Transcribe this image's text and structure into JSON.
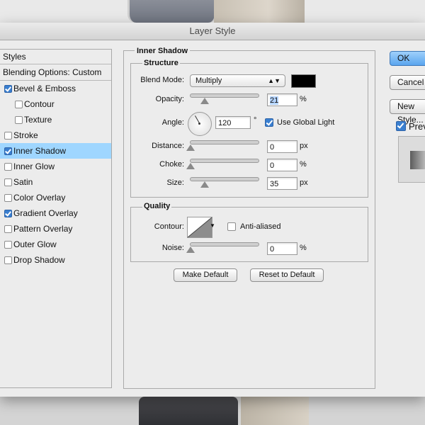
{
  "window": {
    "title": "Layer Style"
  },
  "styles_list": {
    "header": "Styles",
    "blending_options": "Blending Options: Custom",
    "items": [
      {
        "label": "Bevel & Emboss",
        "checked": true,
        "sub": false
      },
      {
        "label": "Contour",
        "checked": false,
        "sub": true
      },
      {
        "label": "Texture",
        "checked": false,
        "sub": true
      },
      {
        "label": "Stroke",
        "checked": false,
        "sub": false
      },
      {
        "label": "Inner Shadow",
        "checked": true,
        "sub": false,
        "selected": true
      },
      {
        "label": "Inner Glow",
        "checked": false,
        "sub": false
      },
      {
        "label": "Satin",
        "checked": false,
        "sub": false
      },
      {
        "label": "Color Overlay",
        "checked": false,
        "sub": false
      },
      {
        "label": "Gradient Overlay",
        "checked": true,
        "sub": false
      },
      {
        "label": "Pattern Overlay",
        "checked": false,
        "sub": false
      },
      {
        "label": "Outer Glow",
        "checked": false,
        "sub": false
      },
      {
        "label": "Drop Shadow",
        "checked": false,
        "sub": false
      }
    ]
  },
  "panel": {
    "title": "Inner Shadow",
    "structure": {
      "title": "Structure",
      "blend_mode_label": "Blend Mode:",
      "blend_mode_value": "Multiply",
      "blend_color": "#000000",
      "opacity_label": "Opacity:",
      "opacity_value": "21",
      "opacity_unit": "%",
      "angle_label": "Angle:",
      "angle_value": "120",
      "angle_unit": "°",
      "use_global_light_label": "Use Global Light",
      "use_global_light": true,
      "distance_label": "Distance:",
      "distance_value": "0",
      "distance_unit": "px",
      "choke_label": "Choke:",
      "choke_value": "0",
      "choke_unit": "%",
      "size_label": "Size:",
      "size_value": "35",
      "size_unit": "px"
    },
    "quality": {
      "title": "Quality",
      "contour_label": "Contour:",
      "anti_aliased_label": "Anti-aliased",
      "anti_aliased": false,
      "noise_label": "Noise:",
      "noise_value": "0",
      "noise_unit": "%"
    },
    "buttons": {
      "make_default": "Make Default",
      "reset_default": "Reset to Default"
    }
  },
  "right_buttons": {
    "ok": "OK",
    "cancel": "Cancel",
    "new_style": "New Style...",
    "preview_label": "Preview",
    "preview_checked": true
  }
}
